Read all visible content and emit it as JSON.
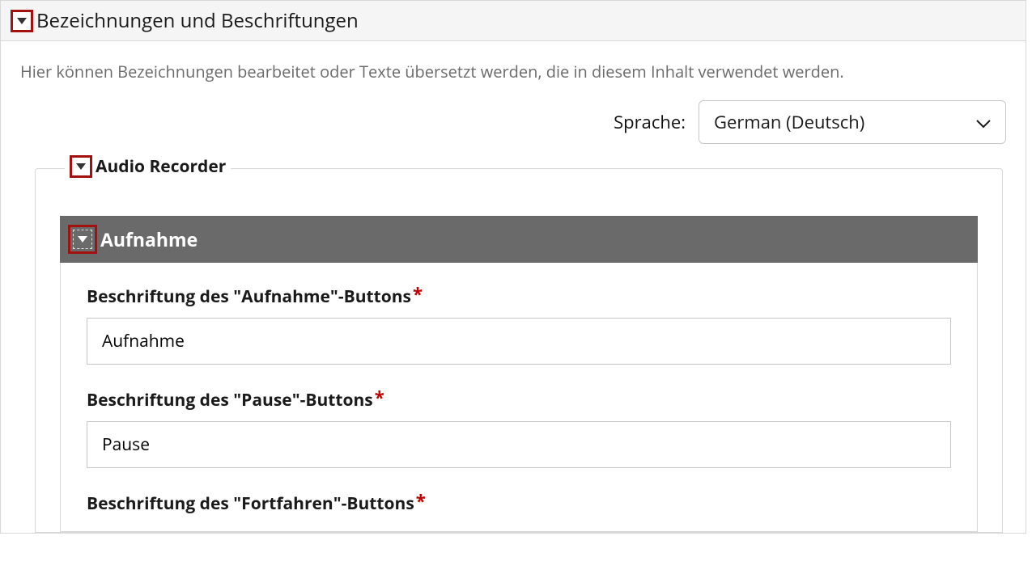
{
  "panel": {
    "title": "Bezeichnungen und Beschriftungen",
    "description": "Hier können Bezeichnungen bearbeitet oder Texte übersetzt werden, die in diesem Inhalt verwendet werden."
  },
  "language": {
    "label": "Sprache:",
    "selected": "German (Deutsch)"
  },
  "inner": {
    "title": "Audio Recorder"
  },
  "section": {
    "title": "Aufnahme"
  },
  "fields": {
    "record": {
      "label": "Beschriftung des \"Aufnahme\"-Buttons",
      "value": "Aufnahme"
    },
    "pause": {
      "label": "Beschriftung des \"Pause\"-Buttons",
      "value": "Pause"
    },
    "continue": {
      "label": "Beschriftung des \"Fortfahren\"-Buttons"
    }
  },
  "glyphs": {
    "required": "*"
  }
}
